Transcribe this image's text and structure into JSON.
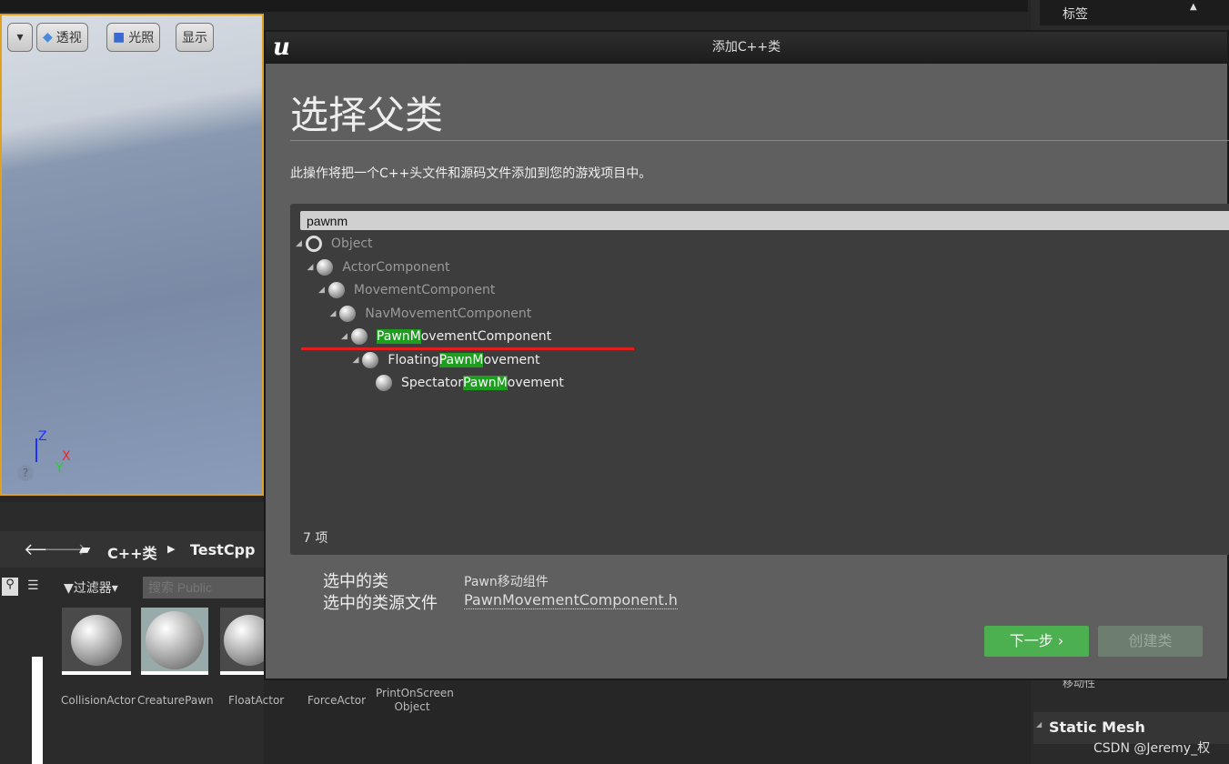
{
  "viewport": {
    "buttons": [
      "透视",
      "光照",
      "显示"
    ],
    "axes": {
      "z": "Z",
      "x": "X",
      "y": "Y"
    }
  },
  "right_panel": {
    "tags_label": "标签",
    "mobility_label": "移动性",
    "static_mesh_label": "Static Mesh"
  },
  "content_browser": {
    "breadcrumb": [
      "C++类",
      "TestCpp"
    ],
    "filter_label": "过滤器",
    "search_placeholder": "搜索 Public",
    "assets": [
      "CollisionActor",
      "CreaturePawn",
      "FloatActor",
      "ForceActor",
      "PrintOnScreen Object"
    ]
  },
  "dialog": {
    "title": "添加C++类",
    "heading": "选择父类",
    "description": "此操作将把一个C++头文件和源码文件添加到您的游戏项目中。",
    "search_value": "pawnm",
    "tree": [
      {
        "pre": "Object",
        "hl": "",
        "post": "",
        "icon": "circle-icon",
        "match": false
      },
      {
        "pre": "ActorComponent",
        "hl": "",
        "post": "",
        "icon": "component-icon",
        "match": false
      },
      {
        "pre": "MovementComponent",
        "hl": "",
        "post": "",
        "icon": "component-icon",
        "match": false
      },
      {
        "pre": "NavMovementComponent",
        "hl": "",
        "post": "",
        "icon": "component-icon",
        "match": false
      },
      {
        "pre": "",
        "hl": "PawnM",
        "post": "ovementComponent",
        "icon": "component-icon",
        "match": true
      },
      {
        "pre": "Floating",
        "hl": "PawnM",
        "post": "ovement",
        "icon": "component-icon",
        "match": true
      },
      {
        "pre": "Spectator",
        "hl": "PawnM",
        "post": "ovement",
        "icon": "component-icon",
        "match": true
      }
    ],
    "count": "7 项",
    "selected_class_label": "选中的类",
    "selected_class_value": "Pawn移动组件",
    "selected_source_label": "选中的类源文件",
    "selected_source_value": "PawnMovementComponent.h",
    "next_button": "下一步",
    "create_button": "创建类"
  },
  "watermark": "CSDN @Jeremy_权",
  "colors": {
    "accent_green": "#4caf50",
    "highlight": "#1e9e1e",
    "underline": "#e02020",
    "viewport_border": "#e0a020"
  }
}
